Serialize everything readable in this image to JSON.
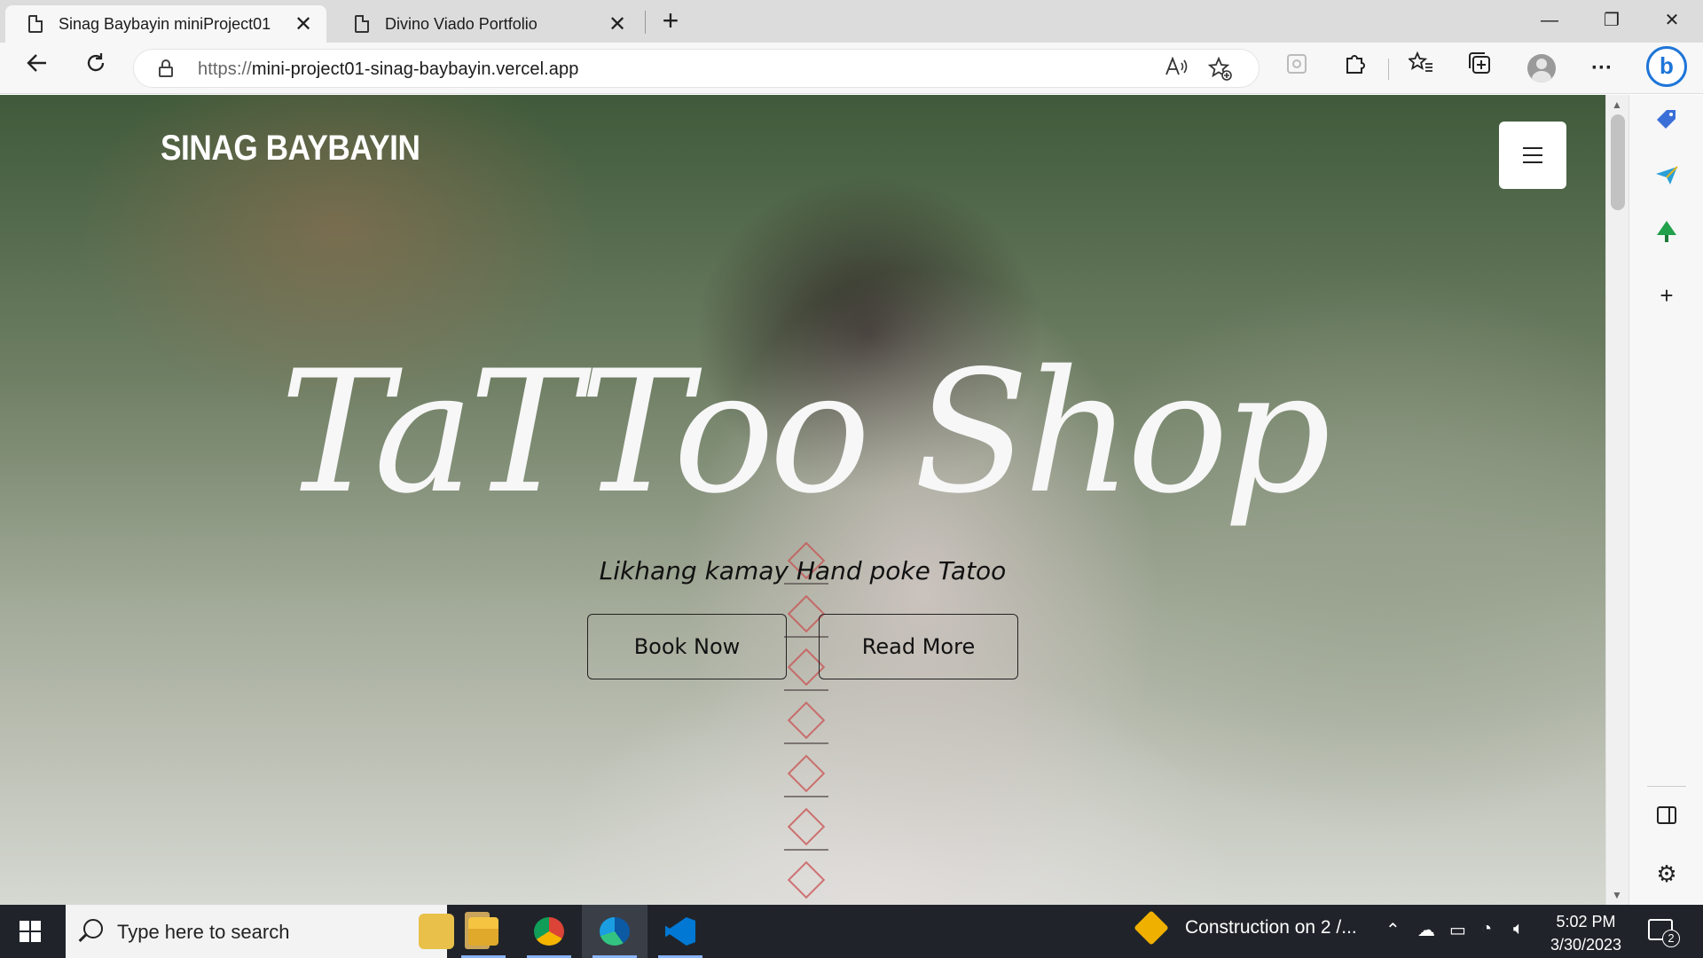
{
  "browser": {
    "tabs": [
      {
        "title": "Sinag Baybayin miniProject01",
        "active": true
      },
      {
        "title": "Divino Viado Portfolio",
        "active": false
      }
    ],
    "new_tab_symbol": "+",
    "tab_close_symbol": "✕",
    "window_controls": {
      "minimize": "—",
      "maximize": "❐",
      "close": "✕"
    },
    "address": {
      "scheme": "https://",
      "host": "mini-project01-sinag-baybayin.vercel.app"
    },
    "toolbar_icons": [
      "back-icon",
      "refresh-icon",
      "lock-icon",
      "read-aloud-icon",
      "add-favorite-icon",
      "extension-puzzle-icon",
      "favorites-icon",
      "collections-icon",
      "profile-icon",
      "more-icon",
      "bing-icon"
    ],
    "more_symbol": "···",
    "bing_letter": "b"
  },
  "page": {
    "brand": "SINAG BAYBAYIN",
    "hero_title": "TaTToo Shop",
    "hero_subtitle": "Likhang kamay Hand poke Tatoo",
    "buttons": {
      "book": "Book Now",
      "read": "Read More"
    }
  },
  "sidebar": {
    "icons": [
      "tag-icon",
      "send-icon",
      "tree-icon",
      "add-icon",
      "split-screen-icon",
      "settings-icon"
    ],
    "add_symbol": "+",
    "settings_symbol": "⚙"
  },
  "taskbar": {
    "search_placeholder": "Type here to search",
    "apps": [
      "file-explorer-icon",
      "chrome-icon",
      "edge-icon",
      "vscode-icon"
    ],
    "weather_text": "Construction on 2 /...",
    "time": "5:02 PM",
    "date": "3/30/2023",
    "notification_count": "2"
  }
}
